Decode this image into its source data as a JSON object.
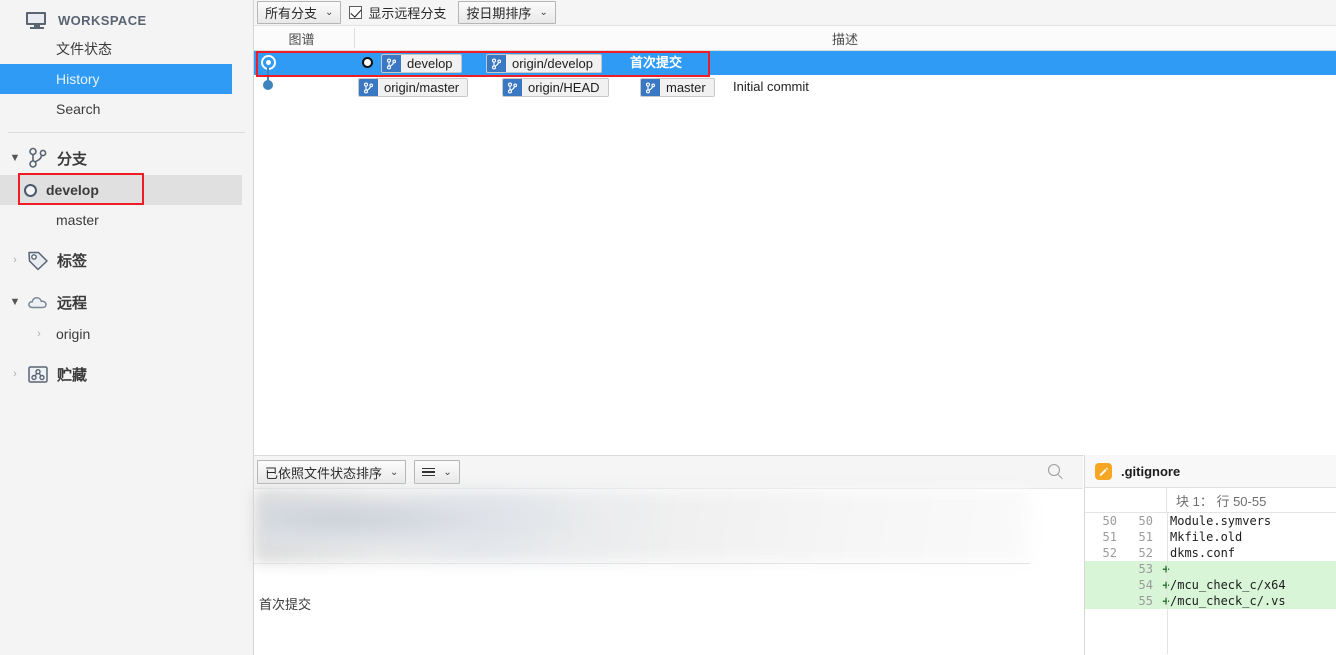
{
  "sidebar": {
    "workspace": {
      "label": "WORKSPACE",
      "icon": "monitor-icon"
    },
    "nav": [
      {
        "label": "文件状态",
        "selected": false
      },
      {
        "label": "History",
        "selected": true
      },
      {
        "label": "Search",
        "selected": false
      }
    ],
    "groups": [
      {
        "name": "分支",
        "icon": "branch-icon",
        "expanded": true,
        "twisty": "▼",
        "children": [
          {
            "label": "develop",
            "current": true,
            "highlighted": true
          },
          {
            "label": "master",
            "current": false,
            "highlighted": false
          }
        ]
      },
      {
        "name": "标签",
        "icon": "tag-icon",
        "expanded": false,
        "twisty": "›",
        "children": []
      },
      {
        "name": "远程",
        "icon": "cloud-icon",
        "expanded": true,
        "twisty": "▼",
        "children": [
          {
            "label": "origin",
            "twisty": "›"
          }
        ]
      },
      {
        "name": "贮藏",
        "icon": "stash-icon",
        "expanded": false,
        "twisty": "›",
        "children": []
      }
    ]
  },
  "toolbar": {
    "branch_filter": {
      "label": "所有分支",
      "caret": "⌄"
    },
    "show_remote": {
      "label": "显示远程分支",
      "checked": true
    },
    "sort_order": {
      "label": "按日期排序",
      "caret": "⌄"
    }
  },
  "columns": {
    "graph": "图谱",
    "description": "描述"
  },
  "commits": [
    {
      "selected": true,
      "message": "首次提交",
      "refs": [
        {
          "label": "develop",
          "icon": "branch-chip-icon"
        },
        {
          "label": "origin/develop",
          "icon": "branch-chip-icon"
        }
      ]
    },
    {
      "selected": false,
      "message": "Initial commit",
      "refs": [
        {
          "label": "origin/master",
          "icon": "branch-chip-icon"
        },
        {
          "label": "origin/HEAD",
          "icon": "branch-chip-icon"
        },
        {
          "label": "master",
          "icon": "branch-chip-icon"
        }
      ]
    }
  ],
  "file_panel": {
    "sort_button": {
      "label": "已依照文件状态排序",
      "caret": "⌄"
    },
    "view_button": {
      "icon": "list-view-icon",
      "caret": "⌄"
    },
    "search_icon": "search-icon",
    "commit_message": "首次提交"
  },
  "diff_panel": {
    "file_icon": "edit-file-icon",
    "file_name": ".gitignore",
    "hunk_header": "块 1： 行 50-55",
    "lines": [
      {
        "old": "50",
        "new": "50",
        "sign": "",
        "text": "Module.symvers",
        "type": "ctx"
      },
      {
        "old": "51",
        "new": "51",
        "sign": "",
        "text": "Mkfile.old",
        "type": "ctx"
      },
      {
        "old": "52",
        "new": "52",
        "sign": "",
        "text": "dkms.conf",
        "type": "ctx"
      },
      {
        "old": "",
        "new": "53",
        "sign": "+",
        "text": "",
        "type": "add"
      },
      {
        "old": "",
        "new": "54",
        "sign": "+",
        "text": "/mcu_check_c/x64",
        "type": "add"
      },
      {
        "old": "",
        "new": "55",
        "sign": "+",
        "text": "/mcu_check_c/.vs",
        "type": "add"
      }
    ]
  },
  "colors": {
    "accent_blue": "#2f9bf5",
    "chip_icon_blue": "#3b78c3",
    "highlight_red": "#ee1c25",
    "add_green": "#d8f5d8",
    "file_icon_orange": "#f5a623"
  }
}
